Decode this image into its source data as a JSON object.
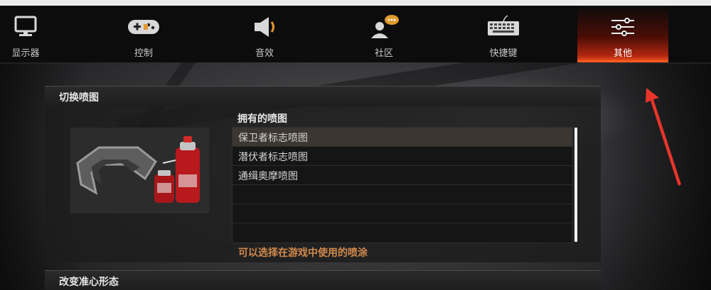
{
  "nav": {
    "items": [
      {
        "label": "显示器",
        "icon": "monitor-icon"
      },
      {
        "label": "控制",
        "icon": "gamepad-icon"
      },
      {
        "label": "音效",
        "icon": "speaker-icon"
      },
      {
        "label": "社区",
        "icon": "community-chat-icon"
      },
      {
        "label": "快捷键",
        "icon": "keyboard-icon"
      },
      {
        "label": "其他",
        "icon": "sliders-icon",
        "active": true
      }
    ]
  },
  "spray_section": {
    "title": "切换喷图",
    "list_title": "拥有的喷图",
    "items": [
      "保卫者标志喷图",
      "潜伏者标志喷图",
      "通缉奥摩喷图",
      "",
      "",
      ""
    ],
    "selected_index": 0,
    "hint": "可以选择在游戏中使用的喷涂"
  },
  "crosshair_section": {
    "title": "改变准心形态"
  },
  "colors": {
    "accent": "#e04a1d",
    "hint": "#d38a4c",
    "annotation_arrow": "#e8352b"
  }
}
